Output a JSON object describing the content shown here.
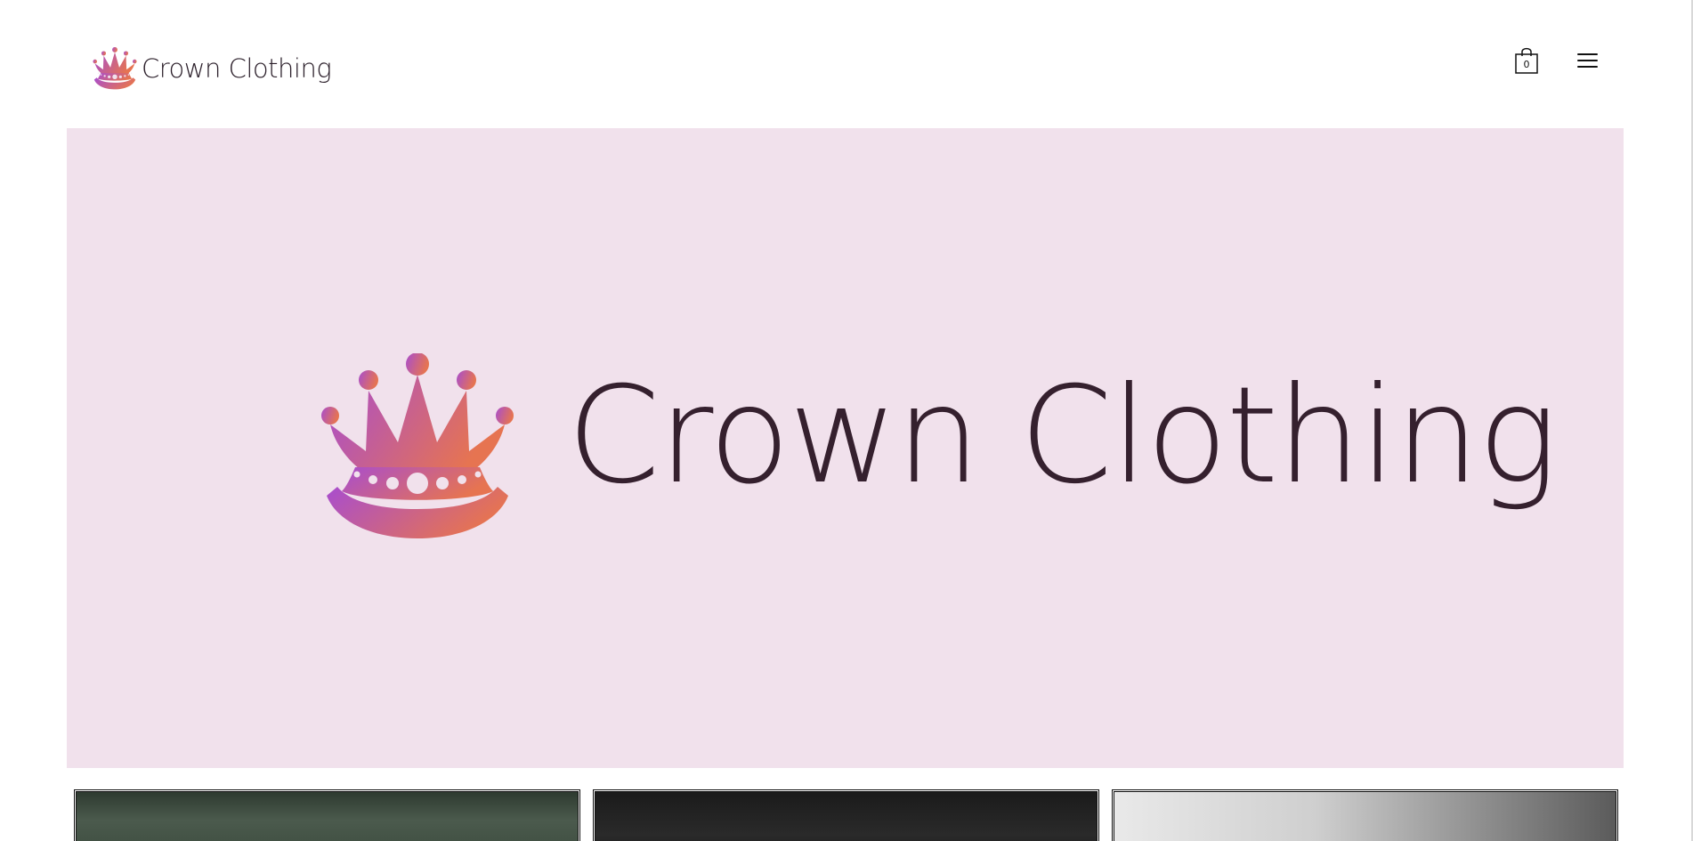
{
  "header": {
    "logo_text": "Crown Clothing",
    "cart_count": "0",
    "cart_icon": "shopping-bag-icon",
    "menu_icon": "hamburger-menu-icon"
  },
  "hero": {
    "brand_text": "Crown Clothing",
    "background_color": "#f1e1ec"
  },
  "brand_colors": {
    "crown_gradient_start": "#b04bc9",
    "crown_gradient_end": "#e2725a",
    "text_color": "#35202e"
  },
  "categories": [
    {
      "image": "hats-photo"
    },
    {
      "image": "jackets-photo"
    },
    {
      "image": "sneakers-photo"
    }
  ]
}
